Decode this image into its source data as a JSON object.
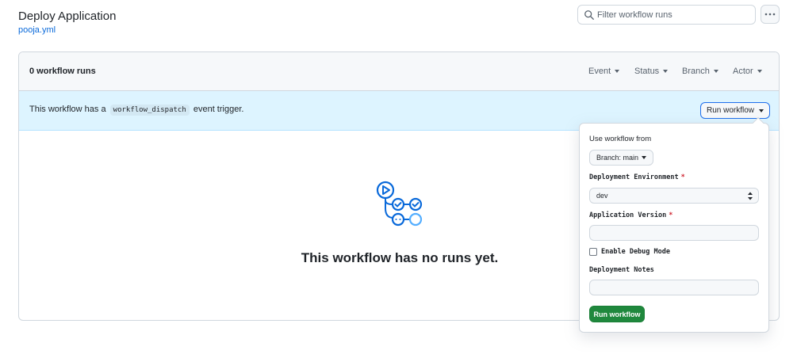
{
  "header": {
    "title": "Deploy Application",
    "workflow_file": "pooja.yml"
  },
  "search": {
    "placeholder": "Filter workflow runs",
    "icon": "search-icon"
  },
  "more_menu": {
    "icon": "kebab-horizontal-icon"
  },
  "runs": {
    "count_label": "0 workflow runs",
    "filters": [
      "Event",
      "Status",
      "Branch",
      "Actor"
    ]
  },
  "dispatch": {
    "text_before": "This workflow has a",
    "code": "workflow_dispatch",
    "text_after": "event trigger.",
    "run_button": "Run workflow"
  },
  "empty_state": {
    "icon": "workflow-icon",
    "message": "This workflow has no runs yet."
  },
  "run_form": {
    "use_from_label": "Use workflow from",
    "branch_button": "Branch: main",
    "environment": {
      "label": "Deployment Environment",
      "required": "*",
      "value": "dev"
    },
    "version": {
      "label": "Application Version",
      "required": "*",
      "value": ""
    },
    "debug": {
      "label": "Enable Debug Mode",
      "checked": false
    },
    "notes": {
      "label": "Deployment Notes",
      "value": ""
    },
    "submit": "Run workflow"
  },
  "colors": {
    "accent": "#0969da",
    "banner": "#ddf4ff",
    "primary_button": "#1f883d",
    "required": "#cf222e"
  }
}
